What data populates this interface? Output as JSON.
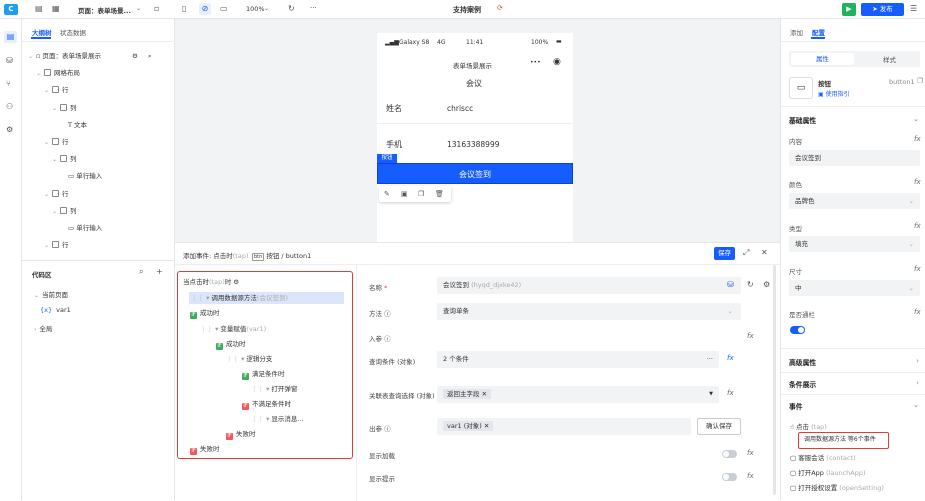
{
  "topbar": {
    "page_label": "页面：表单场景...",
    "zoom": "100%",
    "title": "支持案例",
    "publish_label": "发布",
    "more_label": "···"
  },
  "left": {
    "tabs": [
      "大纲树",
      "状态数据"
    ],
    "tree": [
      {
        "label": "页面：表单场景展示",
        "depth": 0,
        "icon": "page"
      },
      {
        "label": "网格布局",
        "depth": 1,
        "icon": "grid"
      },
      {
        "label": "行",
        "depth": 2,
        "icon": "grid"
      },
      {
        "label": "列",
        "depth": 3,
        "icon": "grid"
      },
      {
        "label": "文本",
        "depth": 4,
        "icon": "text"
      },
      {
        "label": "行",
        "depth": 2,
        "icon": "grid"
      },
      {
        "label": "列",
        "depth": 3,
        "icon": "grid"
      },
      {
        "label": "单行输入",
        "depth": 4,
        "icon": "input"
      },
      {
        "label": "行",
        "depth": 2,
        "icon": "grid"
      },
      {
        "label": "列",
        "depth": 3,
        "icon": "grid"
      },
      {
        "label": "单行输入",
        "depth": 4,
        "icon": "input"
      },
      {
        "label": "行",
        "depth": 2,
        "icon": "grid"
      }
    ],
    "code_area_title": "代码区",
    "current_page": "当前页面",
    "var1": "var1",
    "global": "全局"
  },
  "phone": {
    "status_device": "Galaxy S8",
    "status_net": "4G",
    "status_time": "11:41",
    "status_battery": "100%",
    "nav_title": "表单场景展示",
    "nav_dots": "•••",
    "page_title": "会议",
    "name_label": "姓名",
    "name_value": "chriscc",
    "phone_label": "手机",
    "phone_value": "13163388999",
    "button_tag": "按钮",
    "button_label": "会议签到"
  },
  "event": {
    "header_title": "添加事件: 点击时",
    "header_tap": "(tap)",
    "header_component": "按钮 / button1",
    "save_label": "保存",
    "flow": [
      {
        "label": "当点击时",
        "sub": "(tap)",
        "suffix": "时",
        "kind": "trigger"
      },
      {
        "label": "调用数据源方法",
        "sub": "(会议签到)",
        "kind": "selected"
      },
      {
        "label": "成功时",
        "kind": "success"
      },
      {
        "label": "变量赋值",
        "sub": "(var1)",
        "kind": "node"
      },
      {
        "label": "成功时",
        "kind": "success"
      },
      {
        "label": "逻辑分支",
        "kind": "node"
      },
      {
        "label": "满足条件时",
        "kind": "success"
      },
      {
        "label": "打开弹窗",
        "kind": "node"
      },
      {
        "label": "不满足条件时",
        "kind": "fail"
      },
      {
        "label": "显示消息...",
        "kind": "node"
      },
      {
        "label": "失败时",
        "kind": "fail"
      },
      {
        "label": "失败时",
        "kind": "fail"
      }
    ],
    "form": {
      "name_label": "名称",
      "name_value": "会议签到",
      "name_id": "(hyqd_djxke42)",
      "method_label": "方法",
      "method_value": "查询单条",
      "input_label": "入参",
      "query_label": "查询条件 (对象)",
      "query_value": "2 个条件",
      "join_label": "关联表查询选择 (对象)",
      "join_value": "返回主字段",
      "out_label": "出参",
      "out_value": "var1 (对象)",
      "confirm_label": "确认保存",
      "loading_label": "显示加载",
      "tip_label": "显示提示"
    }
  },
  "right": {
    "tabs": [
      "添加",
      "配置"
    ],
    "subtabs": [
      "属性",
      "样式"
    ],
    "comp_name": "按钮",
    "comp_id": "button1",
    "comp_guide": "使用指引",
    "basic_title": "基础属性",
    "content_label": "内容",
    "content_value": "会议签到",
    "color_label": "颜色",
    "color_value": "品牌色",
    "type_label": "类型",
    "type_value": "填充",
    "size_label": "尺寸",
    "size_value": "中",
    "fill_label": "是否通栏",
    "advanced_title": "高级属性",
    "cond_title": "条件展示",
    "events_title": "事件",
    "events": [
      {
        "label": "点击",
        "sub": "(tap)"
      },
      {
        "label": "调用数据源方法 等6个事件",
        "sub": ""
      },
      {
        "label": "客服会话",
        "sub": "(contact)"
      },
      {
        "label": "打开App",
        "sub": "(launchApp)"
      },
      {
        "label": "打开授权设置",
        "sub": "(openSetting)"
      }
    ]
  },
  "colors": {
    "brand": "#165dff",
    "publish": "#1fb35d",
    "highlight": "#e23b3b"
  }
}
